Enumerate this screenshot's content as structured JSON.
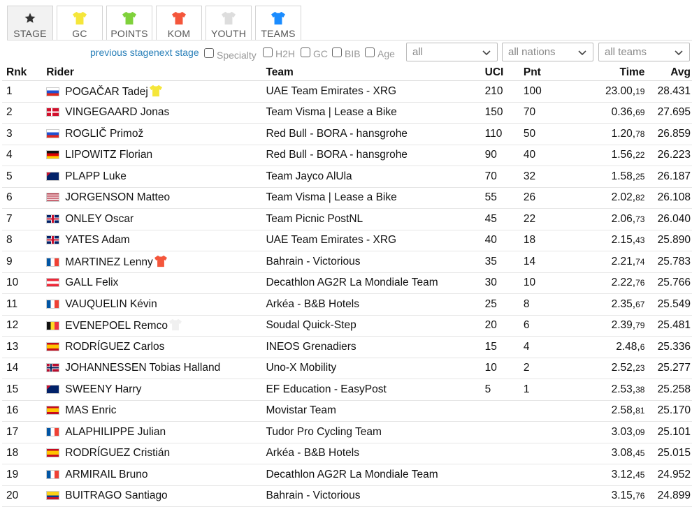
{
  "tabs": [
    {
      "label": "STAGE",
      "icon": "star-icon",
      "color": "#333333",
      "active": true
    },
    {
      "label": "GC",
      "icon": "yellow-jersey-icon",
      "color": "#f5e63a",
      "active": false
    },
    {
      "label": "POINTS",
      "icon": "green-jersey-icon",
      "color": "#7fd13b",
      "active": false
    },
    {
      "label": "KOM",
      "icon": "polka-dot-jersey-icon",
      "color": "#f4563b",
      "active": false
    },
    {
      "label": "YOUTH",
      "icon": "white-jersey-icon",
      "color": "#dddddd",
      "active": false
    },
    {
      "label": "TEAMS",
      "icon": "blue-jersey-icon",
      "color": "#1a8cff",
      "active": false
    }
  ],
  "nav": {
    "previous": "previous stage",
    "next": "next stage"
  },
  "filters": {
    "checkboxes": [
      "Specialty",
      "H2H",
      "GC",
      "BIB",
      "Age"
    ],
    "selects": [
      "all",
      "all nations",
      "all teams"
    ]
  },
  "columns": {
    "rnk": "Rnk",
    "rider": "Rider",
    "team": "Team",
    "uci": "UCI",
    "pnt": "Pnt",
    "time": "Time",
    "avg": "Avg"
  },
  "rows": [
    {
      "rnk": "1",
      "flag": "si",
      "rider": "POGAČAR Tadej",
      "jersey": "yellow",
      "team": "UAE Team Emirates - XRG",
      "uci": "210",
      "pnt": "100",
      "time_main": "23.00,",
      "time_sub": "19",
      "avg": "28.431"
    },
    {
      "rnk": "2",
      "flag": "dk",
      "rider": "VINGEGAARD Jonas",
      "jersey": "",
      "team": "Team Visma | Lease a Bike",
      "uci": "150",
      "pnt": "70",
      "time_main": "0.36,",
      "time_sub": "69",
      "avg": "27.695"
    },
    {
      "rnk": "3",
      "flag": "si",
      "rider": "ROGLIČ Primož",
      "jersey": "",
      "team": "Red Bull - BORA - hansgrohe",
      "uci": "110",
      "pnt": "50",
      "time_main": "1.20,",
      "time_sub": "78",
      "avg": "26.859"
    },
    {
      "rnk": "4",
      "flag": "de",
      "rider": "LIPOWITZ Florian",
      "jersey": "",
      "team": "Red Bull - BORA - hansgrohe",
      "uci": "90",
      "pnt": "40",
      "time_main": "1.56,",
      "time_sub": "22",
      "avg": "26.223"
    },
    {
      "rnk": "5",
      "flag": "au",
      "rider": "PLAPP Luke",
      "jersey": "",
      "team": "Team Jayco AlUla",
      "uci": "70",
      "pnt": "32",
      "time_main": "1.58,",
      "time_sub": "25",
      "avg": "26.187"
    },
    {
      "rnk": "6",
      "flag": "us",
      "rider": "JORGENSON Matteo",
      "jersey": "",
      "team": "Team Visma | Lease a Bike",
      "uci": "55",
      "pnt": "26",
      "time_main": "2.02,",
      "time_sub": "82",
      "avg": "26.108"
    },
    {
      "rnk": "7",
      "flag": "gb",
      "rider": "ONLEY Oscar",
      "jersey": "",
      "team": "Team Picnic PostNL",
      "uci": "45",
      "pnt": "22",
      "time_main": "2.06,",
      "time_sub": "73",
      "avg": "26.040"
    },
    {
      "rnk": "8",
      "flag": "gb",
      "rider": "YATES Adam",
      "jersey": "",
      "team": "UAE Team Emirates - XRG",
      "uci": "40",
      "pnt": "18",
      "time_main": "2.15,",
      "time_sub": "43",
      "avg": "25.890"
    },
    {
      "rnk": "9",
      "flag": "fr",
      "rider": "MARTINEZ Lenny",
      "jersey": "red",
      "team": "Bahrain - Victorious",
      "uci": "35",
      "pnt": "14",
      "time_main": "2.21,",
      "time_sub": "74",
      "avg": "25.783"
    },
    {
      "rnk": "10",
      "flag": "at",
      "rider": "GALL Felix",
      "jersey": "",
      "team": "Decathlon AG2R La Mondiale Team",
      "uci": "30",
      "pnt": "10",
      "time_main": "2.22,",
      "time_sub": "76",
      "avg": "25.766"
    },
    {
      "rnk": "11",
      "flag": "fr",
      "rider": "VAUQUELIN Kévin",
      "jersey": "",
      "team": "Arkéa - B&B Hotels",
      "uci": "25",
      "pnt": "8",
      "time_main": "2.35,",
      "time_sub": "67",
      "avg": "25.549"
    },
    {
      "rnk": "12",
      "flag": "be",
      "rider": "EVENEPOEL Remco",
      "jersey": "white",
      "team": "Soudal Quick-Step",
      "uci": "20",
      "pnt": "6",
      "time_main": "2.39,",
      "time_sub": "79",
      "avg": "25.481"
    },
    {
      "rnk": "13",
      "flag": "es",
      "rider": "RODRÍGUEZ Carlos",
      "jersey": "",
      "team": "INEOS Grenadiers",
      "uci": "15",
      "pnt": "4",
      "time_main": "2.48,",
      "time_sub": "6",
      "avg": "25.336"
    },
    {
      "rnk": "14",
      "flag": "no",
      "rider": "JOHANNESSEN Tobias Halland",
      "jersey": "",
      "team": "Uno-X Mobility",
      "uci": "10",
      "pnt": "2",
      "time_main": "2.52,",
      "time_sub": "23",
      "avg": "25.277"
    },
    {
      "rnk": "15",
      "flag": "au",
      "rider": "SWEENY Harry",
      "jersey": "",
      "team": "EF Education - EasyPost",
      "uci": "5",
      "pnt": "1",
      "time_main": "2.53,",
      "time_sub": "38",
      "avg": "25.258"
    },
    {
      "rnk": "16",
      "flag": "es",
      "rider": "MAS Enric",
      "jersey": "",
      "team": "Movistar Team",
      "uci": "",
      "pnt": "",
      "time_main": "2.58,",
      "time_sub": "81",
      "avg": "25.170"
    },
    {
      "rnk": "17",
      "flag": "fr",
      "rider": "ALAPHILIPPE Julian",
      "jersey": "",
      "team": "Tudor Pro Cycling Team",
      "uci": "",
      "pnt": "",
      "time_main": "3.03,",
      "time_sub": "09",
      "avg": "25.101"
    },
    {
      "rnk": "18",
      "flag": "es",
      "rider": "RODRÍGUEZ Cristián",
      "jersey": "",
      "team": "Arkéa - B&B Hotels",
      "uci": "",
      "pnt": "",
      "time_main": "3.08,",
      "time_sub": "45",
      "avg": "25.015"
    },
    {
      "rnk": "19",
      "flag": "fr",
      "rider": "ARMIRAIL Bruno",
      "jersey": "",
      "team": "Decathlon AG2R La Mondiale Team",
      "uci": "",
      "pnt": "",
      "time_main": "3.12,",
      "time_sub": "45",
      "avg": "24.952"
    },
    {
      "rnk": "20",
      "flag": "co",
      "rider": "BUITRAGO Santiago",
      "jersey": "",
      "team": "Bahrain - Victorious",
      "uci": "",
      "pnt": "",
      "time_main": "3.15,",
      "time_sub": "76",
      "avg": "24.899"
    }
  ]
}
